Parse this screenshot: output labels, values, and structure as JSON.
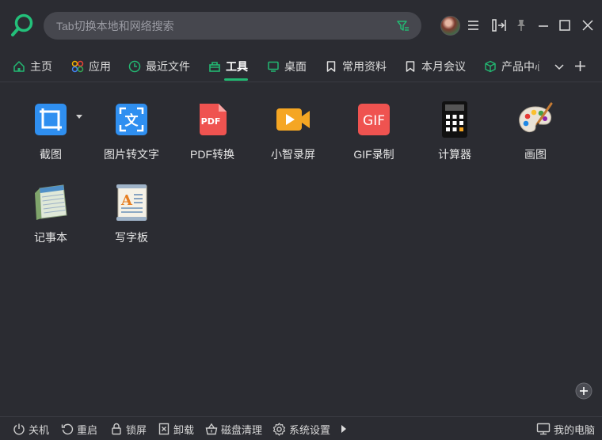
{
  "search": {
    "placeholder": "Tab切换本地和网络搜索"
  },
  "tabs": [
    {
      "label": "主页",
      "icon": "home-icon"
    },
    {
      "label": "应用",
      "icon": "apps-icon"
    },
    {
      "label": "最近文件",
      "icon": "clock-icon"
    },
    {
      "label": "工具",
      "icon": "toolbox-icon",
      "active": true
    },
    {
      "label": "桌面",
      "icon": "monitor-icon"
    },
    {
      "label": "常用资料",
      "icon": "bookmark-icon"
    },
    {
      "label": "本月会议",
      "icon": "bookmark-icon"
    },
    {
      "label": "产品中心",
      "icon": "cube-icon"
    }
  ],
  "tools": [
    {
      "label": "截图",
      "icon": "screenshot-icon"
    },
    {
      "label": "图片转文字",
      "icon": "ocr-icon"
    },
    {
      "label": "PDF转换",
      "icon": "pdf-icon",
      "badge": "PDF"
    },
    {
      "label": "小智录屏",
      "icon": "screen-record-icon"
    },
    {
      "label": "GIF录制",
      "icon": "gif-icon",
      "badge": "GIF"
    },
    {
      "label": "计算器",
      "icon": "calculator-icon"
    },
    {
      "label": "画图",
      "icon": "paint-icon"
    },
    {
      "label": "记事本",
      "icon": "notepad-icon"
    },
    {
      "label": "写字板",
      "icon": "wordpad-icon",
      "badge": "A"
    }
  ],
  "footer": {
    "shutdown": "关机",
    "restart": "重启",
    "lock": "锁屏",
    "uninstall": "卸载",
    "disk_clean": "磁盘清理",
    "settings": "系统设置",
    "my_computer": "我的电脑"
  },
  "colors": {
    "accent": "#23b872",
    "background": "#2b2c32",
    "search_bg": "#46474e"
  }
}
